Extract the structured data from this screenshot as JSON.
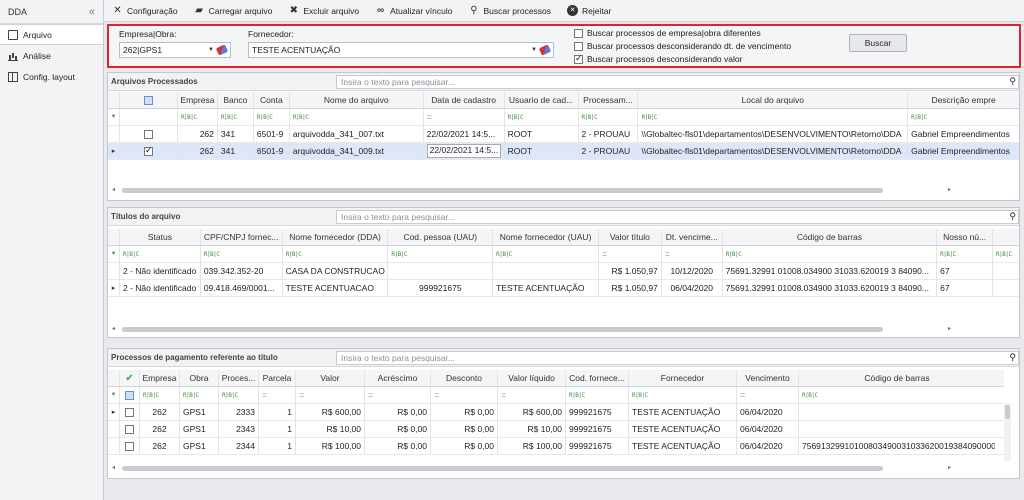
{
  "sidebar": {
    "title": "DDA",
    "collapse": "«",
    "items": [
      {
        "label": "Arquivo",
        "icon": "file-icon"
      },
      {
        "label": "Análise",
        "icon": "chart-icon"
      },
      {
        "label": "Config. layout",
        "icon": "layout-icon"
      }
    ]
  },
  "toolbar": {
    "items": [
      {
        "label": "Configuração",
        "icon": "tools-icon",
        "glyph": "✕"
      },
      {
        "label": "Carregar arquivo",
        "icon": "folder-icon",
        "glyph": "▰"
      },
      {
        "label": "Excluir arquivo",
        "icon": "delete-icon",
        "glyph": "✖"
      },
      {
        "label": "Atualizar vínculo",
        "icon": "link-icon",
        "glyph": "∞"
      },
      {
        "label": "Buscar processos",
        "icon": "search-icon",
        "glyph": "⚲"
      },
      {
        "label": "Rejeitar",
        "icon": "reject-icon",
        "glyph": "✕"
      }
    ]
  },
  "filter": {
    "empresa_label": "Empresa|Obra:",
    "empresa_value": "262|GPS1",
    "fornecedor_label": "Fornecedor:",
    "fornecedor_value": "TESTE ACENTUAÇÃO",
    "checkboxes": [
      {
        "label": "Buscar processos de empresa|obra diferentes",
        "checked": false
      },
      {
        "label": "Buscar processos desconsiderando dt. de vencimento",
        "checked": false
      },
      {
        "label": "Buscar processos desconsiderando valor",
        "checked": true
      }
    ],
    "buscar_label": "Buscar"
  },
  "arquivos": {
    "title": "Arquivos Processados",
    "search_placeholder": "Insira o texto para pesquisar...",
    "columns": [
      "Empresa",
      "Banco",
      "Conta",
      "Nome do arquivo",
      "Data de cadastro",
      "Usuario de cad...",
      "Processam...",
      "Local do arquivo",
      "Descrição empre"
    ],
    "rows": [
      {
        "checked": false,
        "cells": [
          "262",
          "341",
          "6501-9",
          "arquivodda_341_007.txt",
          "22/02/2021 14:5...",
          "ROOT",
          "2 - PROUAU",
          "\\\\Globaltec-fls01\\departamentos\\DESENVOLVIMENTO\\Retorno\\DDA",
          "Gabriel Empreendimentos"
        ]
      },
      {
        "checked": true,
        "cells": [
          "262",
          "341",
          "6501-9",
          "arquivodda_341_009.txt",
          "22/02/2021 14:5...",
          "ROOT",
          "2 - PROUAU",
          "\\\\Globaltec-fls01\\departamentos\\DESENVOLVIMENTO\\Retorno\\DDA",
          "Gabriel Empreendimentos"
        ]
      }
    ]
  },
  "titulos": {
    "title": "Títulos do arquivo",
    "search_placeholder": "Insira o texto para pesquisar...",
    "columns": [
      "Status",
      "CPF/CNPJ fornec...",
      "Nome fornecedor (DDA)",
      "Cod. pessoa (UAU)",
      "Nome fornecedor (UAU)",
      "Valor título",
      "Dt. vencime...",
      "Código de barras",
      "Nosso nú..."
    ],
    "rows": [
      [
        "2 - Não identificado",
        "039.342.352-20",
        "CASA DA CONSTRUCAO ...",
        "",
        "",
        "R$ 1.050,97",
        "10/12/2020",
        "75691.32991 01008.034900 31033.620019 3 84090...",
        "67"
      ],
      [
        "2 - Não identificado",
        "09.418.469/0001...",
        "TESTE ACENTUACAO",
        "999921675",
        "TESTE ACENTUAÇÃO",
        "R$ 1.050,97",
        "06/04/2020",
        "75691.32991 01008.034900 31033.620019 3 84090...",
        "67"
      ]
    ]
  },
  "processos": {
    "title": "Processos de pagamento referente ao título",
    "search_placeholder": "Insira o texto para pesquisar...",
    "columns": [
      "Empresa",
      "Obra",
      "Proces...",
      "Parcela",
      "Valor",
      "Acréscimo",
      "Desconto",
      "Valor líquido",
      "Cod. fornece...",
      "Fornecedor",
      "Vencimento",
      "Código de barras"
    ],
    "rows": [
      [
        "262",
        "GPS1",
        "2333",
        "1",
        "R$ 600,00",
        "R$ 0,00",
        "R$ 0,00",
        "R$ 600,00",
        "999921675",
        "TESTE ACENTUAÇÃO",
        "06/04/2020",
        ""
      ],
      [
        "262",
        "GPS1",
        "2343",
        "1",
        "R$ 10,00",
        "R$ 0,00",
        "R$ 0,00",
        "R$ 10,00",
        "999921675",
        "TESTE ACENTUAÇÃO",
        "06/04/2020",
        ""
      ],
      [
        "262",
        "GPS1",
        "2344",
        "1",
        "R$ 100,00",
        "R$ 0,00",
        "R$ 0,00",
        "R$ 100,00",
        "999921675",
        "TESTE ACENTUAÇÃO",
        "06/04/2020",
        "75691329910100803490031033620019384090000..."
      ]
    ]
  },
  "filter_marker": "R|B|C"
}
